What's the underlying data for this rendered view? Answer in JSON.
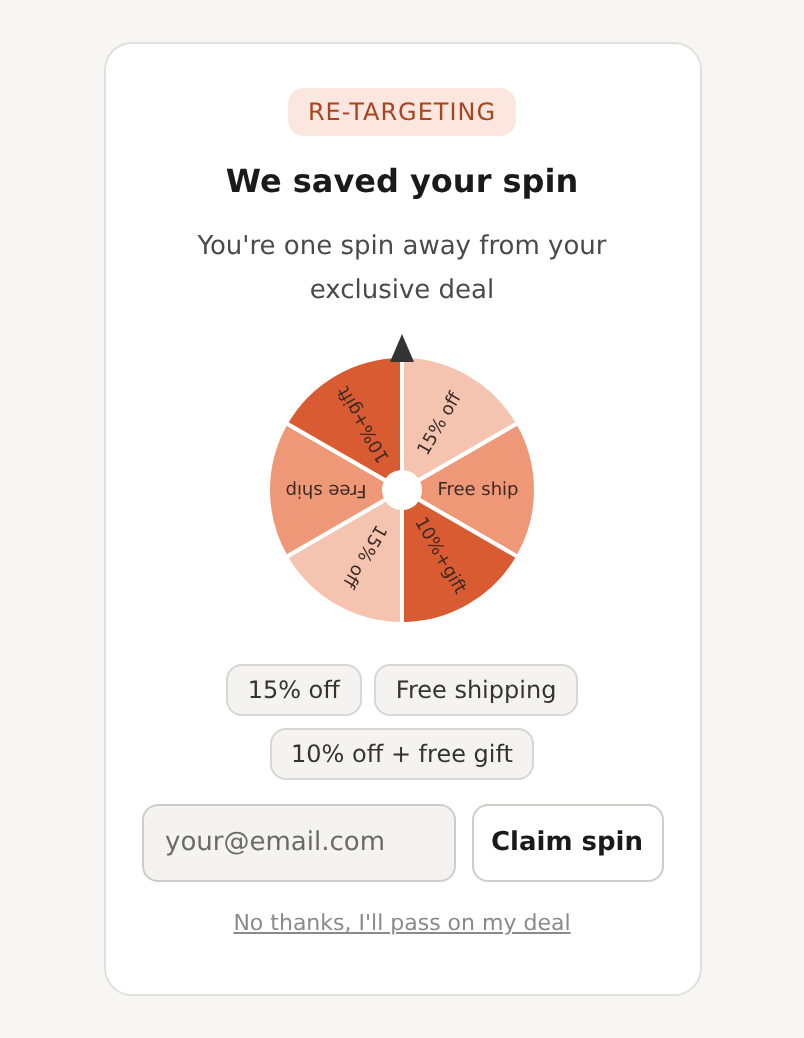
{
  "badge": "RE-TARGETING",
  "title": "We saved your spin",
  "subtitle": "You're one spin away from your exclusive deal",
  "wheel": {
    "segments": [
      {
        "label": "15% off",
        "color": "#f5c4b1"
      },
      {
        "label": "Free ship",
        "color": "#ef9878"
      },
      {
        "label": "10%+gift",
        "color": "#d95b32"
      },
      {
        "label": "15% off",
        "color": "#f5c4b1"
      },
      {
        "label": "Free ship",
        "color": "#ef9878"
      },
      {
        "label": "10%+gift",
        "color": "#d95b32"
      }
    ]
  },
  "prizes": [
    "15% off",
    "Free shipping",
    "10% off + free gift"
  ],
  "email": {
    "placeholder": "your@email.com"
  },
  "submit": "Claim spin",
  "decline": "No thanks, I'll pass on my deal"
}
